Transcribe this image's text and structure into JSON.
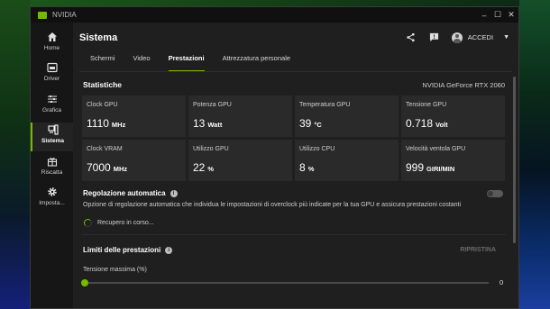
{
  "window": {
    "title": "NVIDIA"
  },
  "sidebar": {
    "items": [
      {
        "label": "Home",
        "icon": "home-icon"
      },
      {
        "label": "Driver",
        "icon": "driver-icon"
      },
      {
        "label": "Grafica",
        "icon": "sliders-icon"
      },
      {
        "label": "Sistema",
        "icon": "system-icon",
        "active": true
      },
      {
        "label": "Riscatta",
        "icon": "gift-icon"
      },
      {
        "label": "Imposta...",
        "icon": "gear-icon"
      }
    ]
  },
  "header": {
    "title": "Sistema",
    "login_label": "ACCEDI"
  },
  "tabs": [
    {
      "label": "Schermi"
    },
    {
      "label": "Video"
    },
    {
      "label": "Prestazioni",
      "active": true
    },
    {
      "label": "Attrezzatura personale"
    }
  ],
  "stats": {
    "title": "Statistiche",
    "gpu_name": "NVIDIA GeForce RTX 2060",
    "cards": [
      {
        "label": "Clock GPU",
        "value": "1110",
        "unit": "MHz"
      },
      {
        "label": "Potenza GPU",
        "value": "13",
        "unit": "Watt"
      },
      {
        "label": "Temperatura GPU",
        "value": "39",
        "unit": "°C"
      },
      {
        "label": "Tensione GPU",
        "value": "0.718",
        "unit": "Volt"
      },
      {
        "label": "Clock VRAM",
        "value": "7000",
        "unit": "MHz"
      },
      {
        "label": "Utilizzo GPU",
        "value": "22",
        "unit": "%"
      },
      {
        "label": "Utilizzo CPU",
        "value": "8",
        "unit": "%"
      },
      {
        "label": "Velocità ventola GPU",
        "value": "999",
        "unit": "GIRI/MIN"
      }
    ]
  },
  "auto_tuning": {
    "title": "Regolazione automatica",
    "description": "Opzione di regolazione automatica che individua le impostazioni di overclock più indicate per la tua GPU e assicura prestazioni costanti",
    "progress_text": "Recupero in corso...",
    "enabled": false
  },
  "limits": {
    "title": "Limiti delle prestazioni",
    "reset_label": "RIPRISTINA",
    "slider_label": "Tensione massima (%)",
    "slider_value": "0"
  },
  "colors": {
    "accent": "#76b900",
    "background": "#1f1f1f",
    "card": "#2a2a2a"
  }
}
